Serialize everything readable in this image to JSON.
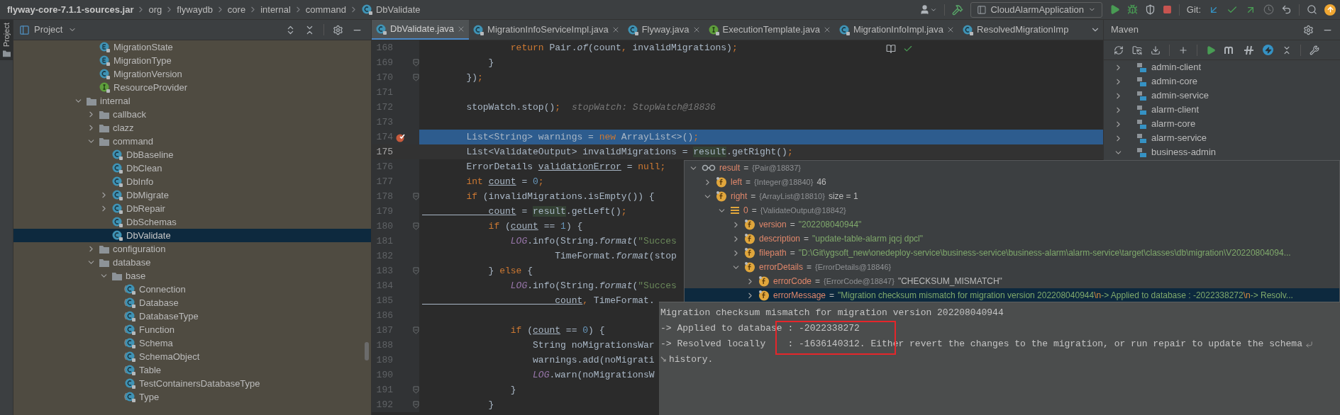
{
  "breadcrumb": [
    {
      "label": "flyway-core-7.1.1-sources.jar",
      "kind": "jar"
    },
    {
      "label": "org",
      "kind": "package"
    },
    {
      "label": "flywaydb",
      "kind": "package"
    },
    {
      "label": "core",
      "kind": "package"
    },
    {
      "label": "internal",
      "kind": "package"
    },
    {
      "label": "command",
      "kind": "package"
    },
    {
      "label": "DbValidate",
      "kind": "class"
    }
  ],
  "toolbar": {
    "run_configuration": "CloudAlarmApplication",
    "git_label": "Git:"
  },
  "side_strip": {
    "label": "Project"
  },
  "project_panel": {
    "title": "Project",
    "tree": {
      "continued_children": [
        {
          "label": "MigrationState",
          "kind": "enum",
          "selected": false
        },
        {
          "label": "MigrationType",
          "kind": "enum",
          "selected": false
        },
        {
          "label": "MigrationVersion",
          "kind": "class",
          "selected": false
        },
        {
          "label": "ResourceProvider",
          "kind": "interface",
          "selected": false
        }
      ],
      "items": [
        {
          "label": "internal",
          "kind": "folder",
          "expanded": true,
          "selected": false,
          "children": [
            {
              "label": "callback",
              "kind": "folder",
              "expanded": false,
              "selected": false
            },
            {
              "label": "clazz",
              "kind": "folder",
              "expanded": false,
              "selected": false
            },
            {
              "label": "command",
              "kind": "folder",
              "expanded": true,
              "selected": false,
              "children": [
                {
                  "label": "DbBaseline",
                  "kind": "class",
                  "selected": false
                },
                {
                  "label": "DbClean",
                  "kind": "class",
                  "selected": false
                },
                {
                  "label": "DbInfo",
                  "kind": "class",
                  "selected": false
                },
                {
                  "label": "DbMigrate",
                  "kind": "class",
                  "expanded": false,
                  "selected": false
                },
                {
                  "label": "DbRepair",
                  "kind": "class",
                  "expanded": false,
                  "selected": false
                },
                {
                  "label": "DbSchemas",
                  "kind": "class",
                  "selected": false
                },
                {
                  "label": "DbValidate",
                  "kind": "class",
                  "selected": true
                }
              ]
            },
            {
              "label": "configuration",
              "kind": "folder",
              "expanded": false,
              "selected": false
            },
            {
              "label": "database",
              "kind": "folder",
              "expanded": true,
              "selected": false,
              "children": [
                {
                  "label": "base",
                  "kind": "folder",
                  "expanded": true,
                  "selected": false,
                  "children": [
                    {
                      "label": "Connection",
                      "kind": "abstract",
                      "selected": false
                    },
                    {
                      "label": "Database",
                      "kind": "abstract",
                      "selected": false
                    },
                    {
                      "label": "DatabaseType",
                      "kind": "abstract",
                      "selected": false
                    },
                    {
                      "label": "Function",
                      "kind": "abstract",
                      "selected": false
                    },
                    {
                      "label": "Schema",
                      "kind": "abstract",
                      "selected": false
                    },
                    {
                      "label": "SchemaObject",
                      "kind": "abstract",
                      "selected": false
                    },
                    {
                      "label": "Table",
                      "kind": "abstract",
                      "selected": false
                    },
                    {
                      "label": "TestContainersDatabaseType",
                      "kind": "class",
                      "selected": false
                    },
                    {
                      "label": "Type",
                      "kind": "abstract",
                      "selected": false
                    }
                  ]
                }
              ]
            }
          ]
        }
      ]
    }
  },
  "editor": {
    "tabs": [
      {
        "label": "DbValidate.java",
        "kind": "class",
        "selected": true,
        "closable": true
      },
      {
        "label": "MigrationInfoServiceImpl.java",
        "kind": "class",
        "selected": false,
        "closable": true
      },
      {
        "label": "Flyway.java",
        "kind": "class",
        "selected": false,
        "closable": true
      },
      {
        "label": "ExecutionTemplate.java",
        "kind": "interface",
        "selected": false,
        "closable": true
      },
      {
        "label": "MigrationInfoImpl.java",
        "kind": "class",
        "selected": false,
        "closable": true
      },
      {
        "label": "ResolvedMigrationImp",
        "kind": "class",
        "selected": false,
        "closable": false
      }
    ],
    "lines": [
      {
        "number": "168",
        "tokens": [
          {
            "text": "                return",
            "kind": "keyword"
          },
          {
            "text": " Pair."
          },
          {
            "text": "of",
            "kind": "static_call"
          },
          {
            "text": "(count"
          },
          {
            "text": ",",
            "kind": "keyword"
          },
          {
            "text": " invalidMigrations)"
          },
          {
            "text": ";",
            "kind": "keyword"
          }
        ]
      },
      {
        "number": "169",
        "fold": true,
        "tokens": [
          {
            "text": "            }"
          }
        ]
      },
      {
        "number": "170",
        "fold": true,
        "tokens": [
          {
            "text": "        })"
          },
          {
            "text": ";",
            "kind": "keyword"
          }
        ]
      },
      {
        "number": "171"
      },
      {
        "number": "172",
        "tokens": [
          {
            "text": "        stopWatch.stop()"
          },
          {
            "text": ";",
            "kind": "keyword"
          }
        ],
        "hint": "stopWatch: StopWatch@18836"
      },
      {
        "number": "173"
      },
      {
        "number": "174",
        "kind": "execution",
        "breakpoint": true,
        "tokens": [
          {
            "text": "        List<String> warnings = "
          },
          {
            "text": "new",
            "kind": "keyword"
          },
          {
            "text": " ArrayList<>()"
          },
          {
            "text": ";",
            "kind": "keyword"
          }
        ]
      },
      {
        "number": "175",
        "kind": "caret",
        "tokens": [
          {
            "text": "        List<ValidateOutput> invalidMigrations = "
          },
          {
            "text": "result",
            "kind": "usage"
          },
          {
            "text": ".getRight()"
          },
          {
            "text": ";",
            "kind": "keyword"
          }
        ]
      },
      {
        "number": "176",
        "tokens": [
          {
            "text": "        ErrorDetails "
          },
          {
            "text": "validationError",
            "kind": "local_var"
          },
          {
            "text": " = "
          },
          {
            "text": "null",
            "kind": "keyword"
          },
          {
            "text": ";",
            "kind": "keyword"
          }
        ]
      },
      {
        "number": "177",
        "tokens": [
          {
            "text": "        int ",
            "kind": "keyword"
          },
          {
            "text": "count",
            "kind": "local_var"
          },
          {
            "text": " = "
          },
          {
            "text": "0",
            "kind": "number"
          },
          {
            "text": ";",
            "kind": "keyword"
          }
        ]
      },
      {
        "number": "178",
        "fold": true,
        "tokens": [
          {
            "text": "        if",
            "kind": "keyword"
          },
          {
            "text": " (invalidMigrations.isEmpty()) {"
          }
        ]
      },
      {
        "number": "179",
        "tokens": [
          {
            "text": "            count",
            "kind": "local_var"
          },
          {
            "text": " = "
          },
          {
            "text": "result",
            "kind": "usage"
          },
          {
            "text": ".getLeft()"
          },
          {
            "text": ";",
            "kind": "keyword"
          }
        ]
      },
      {
        "number": "180",
        "fold": true,
        "tokens": [
          {
            "text": "            if",
            "kind": "keyword"
          },
          {
            "text": " ("
          },
          {
            "text": "count",
            "kind": "local_var"
          },
          {
            "text": " == "
          },
          {
            "text": "1",
            "kind": "number"
          },
          {
            "text": ") {"
          }
        ]
      },
      {
        "number": "181",
        "tokens": [
          {
            "text": "                LOG",
            "kind": "constant"
          },
          {
            "text": ".info(String."
          },
          {
            "text": "format",
            "kind": "static_call"
          },
          {
            "text": "("
          },
          {
            "text": "\"Succes",
            "kind": "string"
          }
        ]
      },
      {
        "number": "182",
        "tokens": [
          {
            "text": "                        TimeFormat."
          },
          {
            "text": "format",
            "kind": "static_call"
          },
          {
            "text": "(stop"
          }
        ]
      },
      {
        "number": "183",
        "fold": true,
        "tokens": [
          {
            "text": "            } "
          },
          {
            "text": "else",
            "kind": "keyword"
          },
          {
            "text": " {"
          }
        ]
      },
      {
        "number": "184",
        "tokens": [
          {
            "text": "                LOG",
            "kind": "constant"
          },
          {
            "text": ".info(String."
          },
          {
            "text": "format",
            "kind": "static_call"
          },
          {
            "text": "("
          },
          {
            "text": "\"Succes",
            "kind": "string"
          }
        ]
      },
      {
        "number": "185",
        "tokens": [
          {
            "text": "                        count",
            "kind": "local_var"
          },
          {
            "text": ",",
            "kind": "keyword"
          },
          {
            "text": " TimeFormat."
          }
        ]
      },
      {
        "number": "186"
      },
      {
        "number": "187",
        "fold": true,
        "tokens": [
          {
            "text": "                if",
            "kind": "keyword"
          },
          {
            "text": " ("
          },
          {
            "text": "count",
            "kind": "local_var"
          },
          {
            "text": " == "
          },
          {
            "text": "0",
            "kind": "number"
          },
          {
            "text": ") {"
          }
        ]
      },
      {
        "number": "188",
        "tokens": [
          {
            "text": "                    String noMigrationsWar"
          }
        ]
      },
      {
        "number": "189",
        "tokens": [
          {
            "text": "                    warnings.add(noMigrati"
          }
        ]
      },
      {
        "number": "190",
        "tokens": [
          {
            "text": "                    LOG",
            "kind": "constant"
          },
          {
            "text": ".warn(noMigrationsW"
          }
        ]
      },
      {
        "number": "191",
        "fold": true,
        "tokens": [
          {
            "text": "                }"
          }
        ]
      },
      {
        "number": "192",
        "fold": true,
        "tokens": [
          {
            "text": "            }"
          }
        ]
      }
    ]
  },
  "maven": {
    "title": "Maven",
    "items": [
      {
        "label": "admin-client",
        "expanded": false
      },
      {
        "label": "admin-core",
        "expanded": false
      },
      {
        "label": "admin-service",
        "expanded": false
      },
      {
        "label": "alarm-client",
        "expanded": false
      },
      {
        "label": "alarm-core",
        "expanded": false
      },
      {
        "label": "alarm-service",
        "expanded": false
      },
      {
        "label": "business-admin",
        "expanded": true
      }
    ]
  },
  "debug_popup": {
    "variables": [
      {
        "name": "result",
        "op": "=",
        "type": "{Pair@18837}",
        "kind": "watch",
        "expanded": true,
        "selected": false,
        "children": [
          {
            "name": "left",
            "op": "=",
            "type": "{Integer@18840}",
            "value": [
              {
                "text": "46"
              }
            ],
            "kind": "field",
            "expanded": false,
            "selected": false
          },
          {
            "name": "right",
            "op": "=",
            "type": "{ArrayList@18810}",
            "value": [
              {
                "text": "size = 1"
              }
            ],
            "kind": "field",
            "expanded": true,
            "selected": false,
            "children": [
              {
                "name": "0",
                "op": "=",
                "type": "{ValidateOutput@18842}",
                "kind": "array",
                "expanded": true,
                "selected": false,
                "children": [
                  {
                    "name": "version",
                    "op": "=",
                    "value": [
                      {
                        "text": "\"202208040944\"",
                        "kind": "string"
                      }
                    ],
                    "kind": "field",
                    "expanded": false,
                    "selected": false
                  },
                  {
                    "name": "description",
                    "op": "=",
                    "value": [
                      {
                        "text": "\"update-table-alarm jqcj dpcl\"",
                        "kind": "string"
                      }
                    ],
                    "kind": "field",
                    "expanded": false,
                    "selected": false
                  },
                  {
                    "name": "filepath",
                    "op": "=",
                    "value": [
                      {
                        "text": "\"D:\\Git\\ygsoft_new\\onedeploy-service\\business-service\\business-alarm\\alarm-service\\target\\classes\\db\\migration\\V20220804094...",
                        "kind": "string"
                      }
                    ],
                    "kind": "field",
                    "expanded": false,
                    "selected": false
                  },
                  {
                    "name": "errorDetails",
                    "op": "=",
                    "type": "{ErrorDetails@18846}",
                    "kind": "field",
                    "expanded": true,
                    "selected": false,
                    "children": [
                      {
                        "name": "errorCode",
                        "op": "=",
                        "type": "{ErrorCode@18847}",
                        "value": [
                          {
                            "text": "\"CHECKSUM_MISMATCH\""
                          }
                        ],
                        "kind": "field",
                        "expanded": false,
                        "selected": false
                      },
                      {
                        "name": "errorMessage",
                        "op": "=",
                        "value": [
                          {
                            "text": "\"Migration checksum mismatch for migration version 202208040944",
                            "kind": "string"
                          },
                          {
                            "text": "\\n",
                            "kind": "escape"
                          },
                          {
                            "text": "-> Applied to database : -2022338272",
                            "kind": "string"
                          },
                          {
                            "text": "\\n",
                            "kind": "escape"
                          },
                          {
                            "text": "-> Resolv...",
                            "kind": "string"
                          }
                        ],
                        "kind": "field",
                        "expanded": false,
                        "selected": true
                      }
                    ]
                  }
                ]
              }
            ]
          }
        ]
      }
    ],
    "text_lines": [
      {
        "text": "Migration checksum mismatch for migration version 202208040944"
      },
      {
        "text": "-> Applied to database : -2022338272"
      },
      {
        "text": "-> Resolved locally    : -1636140312. Either revert the changes to the migration, or run repair to update the schema",
        "kind": "wrapped"
      },
      {
        "text": "history.",
        "kind": "continuation"
      }
    ]
  }
}
